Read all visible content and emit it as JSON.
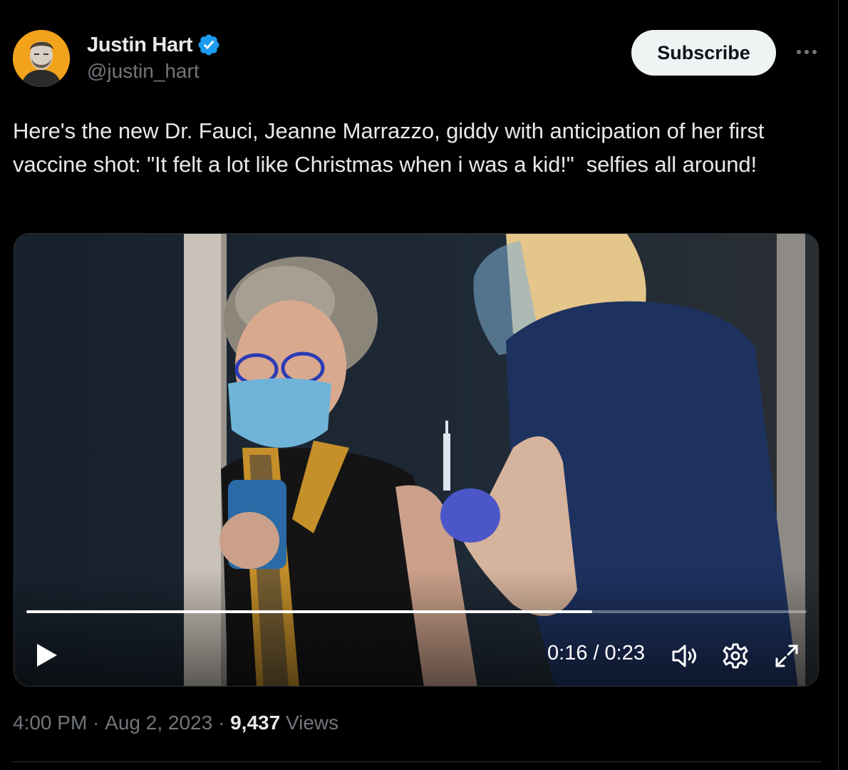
{
  "author": {
    "display_name": "Justin Hart",
    "handle": "@justin_hart",
    "verified": true,
    "avatar_bg": "#f2a31b",
    "verified_color": "#1d9bf0"
  },
  "header": {
    "subscribe_label": "Subscribe",
    "more_icon": "more-horizontal-icon"
  },
  "tweet": {
    "text": "Here's the new Dr. Fauci, Jeanne Marrazzo, giddy with anticipation of her first vaccine shot: \"It felt a lot like Christmas when i was a kid!\"  selfies all around!"
  },
  "video": {
    "current_time": "0:16",
    "separator": "/",
    "duration": "0:23",
    "progress": 0.725,
    "controls": {
      "play_icon": "play-icon",
      "volume_icon": "volume-icon",
      "settings_icon": "gear-icon",
      "fullscreen_icon": "expand-icon"
    }
  },
  "meta": {
    "time": "4:00 PM",
    "dot": " · ",
    "date": "Aug 2, 2023",
    "views_count": "9,437",
    "views_label": " Views"
  }
}
